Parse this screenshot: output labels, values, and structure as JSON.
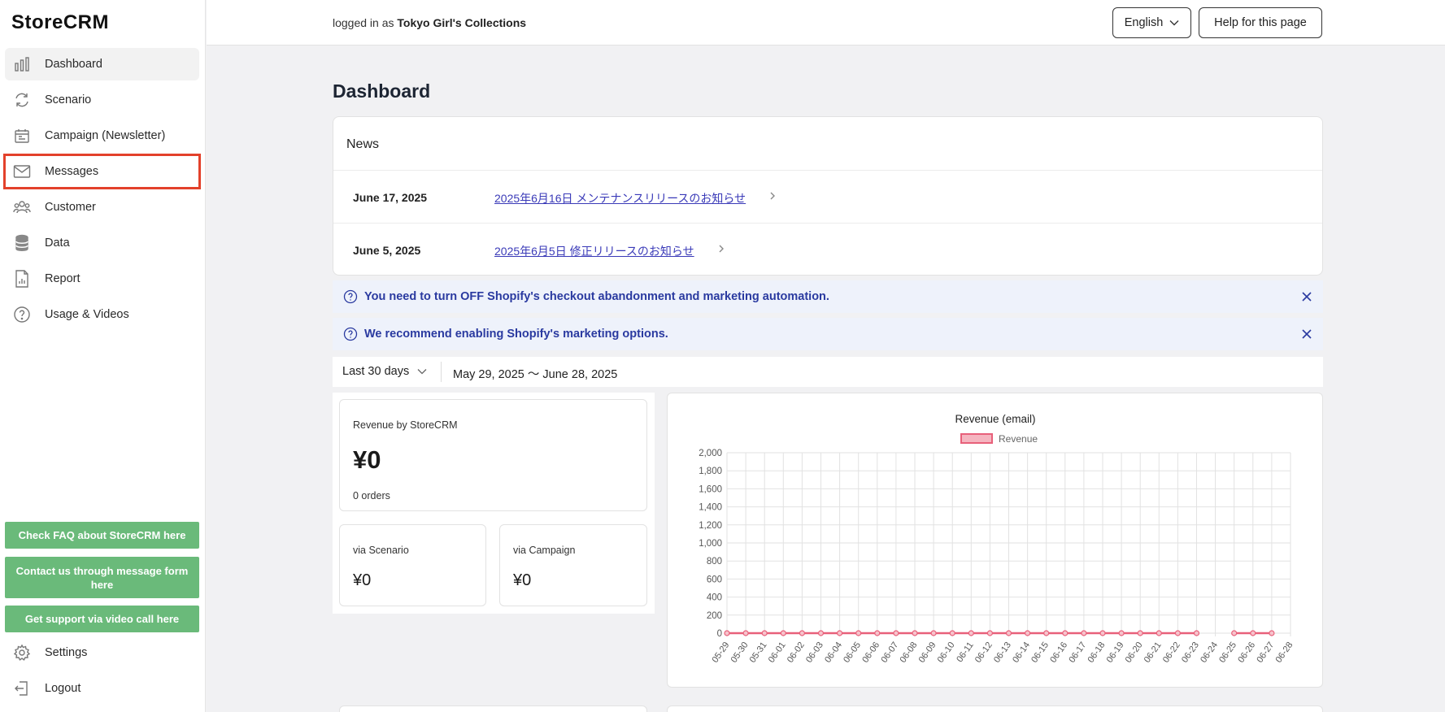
{
  "app": {
    "logo": "StoreCRM"
  },
  "sidebar": {
    "items": [
      {
        "label": "Dashboard",
        "icon": "bar-chart-icon",
        "active": true
      },
      {
        "label": "Scenario",
        "icon": "sync-icon"
      },
      {
        "label": "Campaign (Newsletter)",
        "icon": "calendar-icon"
      },
      {
        "label": "Messages",
        "icon": "mail-icon",
        "highlighted": true
      },
      {
        "label": "Customer",
        "icon": "users-icon"
      },
      {
        "label": "Data",
        "icon": "database-icon"
      },
      {
        "label": "Report",
        "icon": "report-icon"
      },
      {
        "label": "Usage & Videos",
        "icon": "help-circle-icon"
      }
    ],
    "support_buttons": [
      "Check FAQ about StoreCRM here",
      "Contact us through message form here",
      "Get support via video call here"
    ],
    "settings_label": "Settings",
    "logout_label": "Logout"
  },
  "header": {
    "logged_prefix": "logged in as",
    "store_name": "Tokyo Girl's Collections",
    "language": "English",
    "help_label": "Help for this page"
  },
  "main": {
    "title": "Dashboard",
    "news": {
      "title": "News",
      "items": [
        {
          "date": "June 17, 2025",
          "text": "2025年6月16日 メンテナンスリリースのお知らせ"
        },
        {
          "date": "June 5, 2025",
          "text": "2025年6月5日 修正リリースのお知らせ"
        }
      ]
    },
    "banners": [
      "You need to turn OFF Shopify's checkout abandonment and marketing automation.",
      "We recommend enabling Shopify's marketing options."
    ],
    "filter": {
      "period": "Last 30 days",
      "range": "May 29, 2025 〜 June 28, 2025"
    },
    "revenue": {
      "label": "Revenue by StoreCRM",
      "value": "¥0",
      "orders": "0 orders",
      "scenario_label": "via Scenario",
      "scenario_value": "¥0",
      "campaign_label": "via Campaign",
      "campaign_value": "¥0"
    }
  },
  "colors": {
    "accent_green": "#6aba7a",
    "highlight_red": "#e3412b",
    "series_pink": "#e8607a",
    "link_blue": "#3a3ab8"
  },
  "chart_data": {
    "type": "line",
    "title": "Revenue (email)",
    "series": [
      {
        "name": "Revenue",
        "values": [
          0,
          0,
          0,
          0,
          0,
          0,
          0,
          0,
          0,
          0,
          0,
          0,
          0,
          0,
          0,
          0,
          0,
          0,
          0,
          0,
          0,
          0,
          0,
          0,
          0,
          0,
          null,
          0,
          0,
          0
        ]
      }
    ],
    "x": [
      "05-29",
      "05-30",
      "05-31",
      "06-01",
      "06-02",
      "06-03",
      "06-04",
      "06-05",
      "06-06",
      "06-07",
      "06-08",
      "06-09",
      "06-10",
      "06-11",
      "06-12",
      "06-13",
      "06-14",
      "06-15",
      "06-16",
      "06-17",
      "06-18",
      "06-19",
      "06-20",
      "06-21",
      "06-22",
      "06-23",
      "06-24",
      "06-25",
      "06-26",
      "06-27",
      "06-28"
    ],
    "ylim": [
      0,
      2000
    ],
    "yticks": [
      0,
      200,
      400,
      600,
      800,
      1000,
      1200,
      1400,
      1600,
      1800,
      2000
    ],
    "grid": true,
    "legend": "top"
  }
}
